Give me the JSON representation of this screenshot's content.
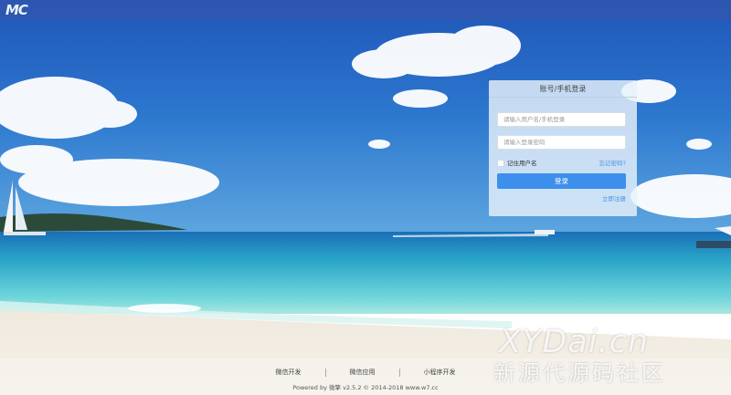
{
  "header": {
    "logo_text": "MC"
  },
  "login": {
    "title": "账号/手机登录",
    "username_placeholder": "请输入用户名/手机登录",
    "password_placeholder": "请输入登录密码",
    "remember_label": "记住用户名",
    "forgot_label": "忘记密码?",
    "submit_label": "登录",
    "register_label": "立即注册"
  },
  "footer": {
    "links": [
      "微信开发",
      "微信应用",
      "小程序开发"
    ],
    "copyright": "Powered by 微擎 v2.5.2 © 2014-2018 www.w7.cc"
  },
  "watermark": {
    "line1": "XYDai.cn",
    "line2": "新源代源码社区"
  },
  "colors": {
    "header": "#2f57b0",
    "button": "#3d8fec",
    "link": "#4a90e2"
  }
}
